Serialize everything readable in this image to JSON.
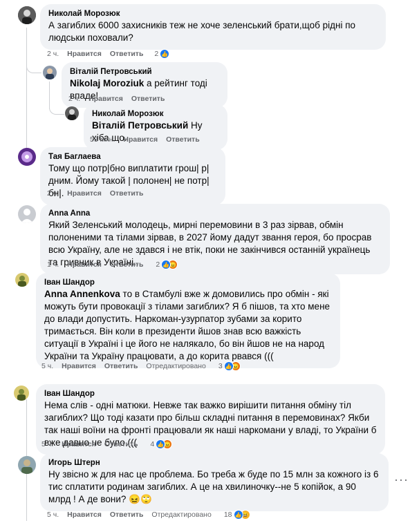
{
  "comments": [
    {
      "author": "Николай Морозюк",
      "text": "А загиблих 6000 захисників теж не хоче зеленський брати,щоб рідні по людськи поховали?",
      "time": "2 ч.",
      "like": "Нравится",
      "reply": "Ответить",
      "reactions": "2"
    },
    {
      "author": "Віталій Петровський",
      "mention": "Nikolaj Moroziuk",
      "text": " а рейтинг тоді впаде!",
      "time": "2 ч.",
      "like": "Нравится",
      "reply": "Ответить"
    },
    {
      "author": "Николай Морозюк",
      "mention": "Віталій Петровський",
      "text": " Ну хіба що.",
      "time": "53 мин.",
      "like": "Нравится",
      "reply": "Ответить"
    },
    {
      "author": "Тая Баглаева",
      "text": "Тому що потр|бно виплатити грош| р|дним. Йому такой | полонен| не потр|бн|.",
      "time": "2 ч.",
      "like": "Нравится",
      "reply": "Ответить"
    },
    {
      "author": "Anna Anna",
      "text": "Який Зеленський молодець, мирні перемовини в 3 раз зірвав, обмін полоненими та тілами зірвав, в 2027 йому дадут звання героя, бо просрав всю Україну, але не здався і не втік, поки не закінчився останній українець та гривник в Україні...",
      "time": "1 ч.",
      "like": "Нравится",
      "reply": "Ответить",
      "reactions": "2"
    },
    {
      "author": "Іван Шандор",
      "mention": "Anna Annenkova",
      "text": " то в Стамбулі вже ж домовились про обмін - які можуть бути провокації з тілами загиблих? Я б пішов, та хто мене до влади допустить. Наркоман-узурпатор зубами за корито тримається. Він коли в президенти йшов знав всю важкість ситуації в Україні і це його не налякало, бо він йшов не на народ України та Україну працювати, а до корита рвався (((",
      "time": "5 ч.",
      "like": "Нравится",
      "reply": "Ответить",
      "edited": "Отредактировано",
      "reactions": "3"
    },
    {
      "author": "Іван Шандор",
      "text": "Нема слів - одні матюки. Невже так важко вирішити питання обміну тіл загиблих? Що тоді казати про більш складні питання в перемовинах? Якби так наші воїни на фронті працювали як наші наркомани у владі, то України б вже давно не було (((",
      "time": "5 ч.",
      "like": "Нравится",
      "reply": "Ответить",
      "reactions": "4"
    },
    {
      "author": "Игорь Штерн",
      "text": "Ну звісно ж для нас це проблема. Бо треба ж буде по 15 млн за кожного із 6 тис сплатити родинам загиблих. А це на хвилиночку--не 5 копійок, а 90 млрд ! А де вони? 😖🙄",
      "time": "5 ч.",
      "like": "Нравится",
      "reply": "Ответить",
      "edited": "Отредактировано",
      "reactions": "18"
    }
  ],
  "icons": {
    "like": "like-reaction-icon",
    "angry": "angry-reaction-icon",
    "haha": "haha-reaction-icon",
    "more": "more-options-icon"
  },
  "colors": {
    "bubble": "#f0f2f5",
    "meta": "#65676b",
    "like": "#1877f2",
    "angry": "#e9710f"
  },
  "more_glyph": "···"
}
